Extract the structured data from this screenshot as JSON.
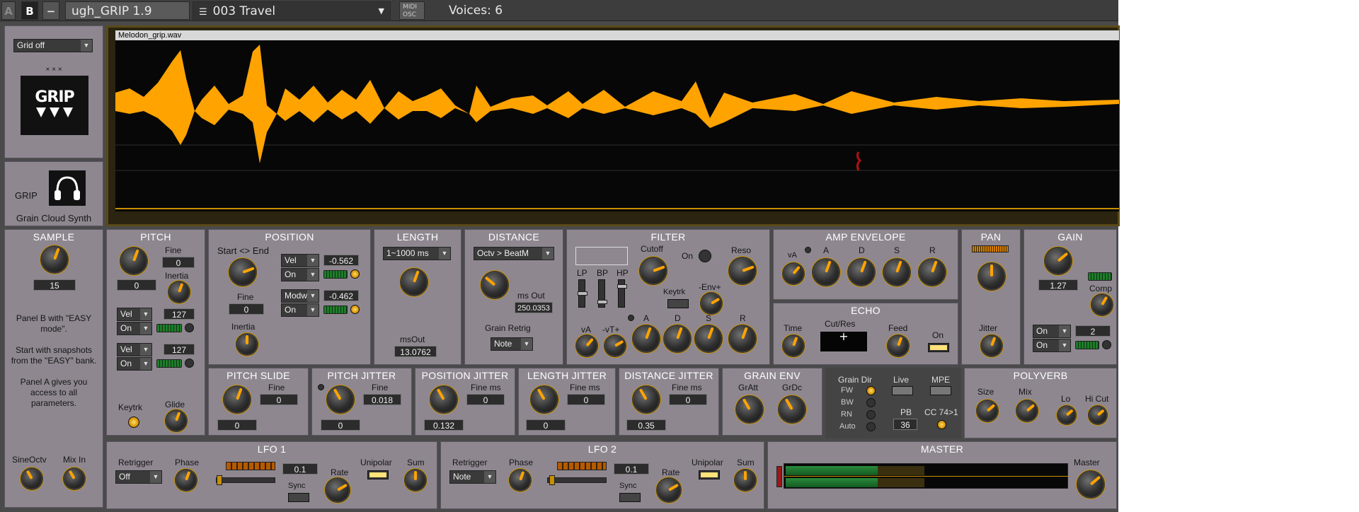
{
  "topbar": {
    "a": "A",
    "b": "B",
    "minus": "−",
    "name": "ugh_GRIP 1.9",
    "preset": "003   Travel",
    "midi1": "MIDI",
    "midi2": "OSC",
    "voices": "Voices: 6"
  },
  "grid": {
    "mode": "Grid off",
    "dots": "× × ×",
    "logo": "GRIP",
    "app": "GRIP",
    "subtitle": "Grain Cloud Synth"
  },
  "wave": {
    "filename": "Melodon_grip.wav"
  },
  "sample": {
    "title": "SAMPLE",
    "value": "15",
    "note": "Panel B with \"EASY mode\".\n\nStart with snapshots from the \"EASY\" bank.\n\nPanel A gives you access to all parameters.",
    "sineoctv": "SineOctv",
    "mixin": "Mix In"
  },
  "pitch": {
    "title": "PITCH",
    "fine": "Fine",
    "fine_val": "0",
    "val": "0",
    "inertia": "Inertia",
    "vel": "Vel",
    "vel_val": "127",
    "on": "On",
    "vel2": "Vel",
    "vel2_val": "127",
    "on2": "On",
    "keytrk": "Keytrk",
    "glide": "Glide"
  },
  "position": {
    "title": "POSITION",
    "startend": "Start <> End",
    "vel": "Vel",
    "vel_val": "-0.562",
    "on": "On",
    "fine": "Fine",
    "fine_val": "0",
    "modw": "Modw",
    "modw_val": "-0.462",
    "on2": "On",
    "inertia": "Inertia"
  },
  "length": {
    "title": "LENGTH",
    "range": "1~1000 ms",
    "msout": "msOut",
    "msout_val": "13.0762"
  },
  "distance": {
    "title": "DISTANCE",
    "mode": "Octv > BeatM",
    "msout": "ms Out",
    "msout_val": "250.0353",
    "retrig": "Grain Retrig",
    "retrig_val": "Note"
  },
  "filter": {
    "title": "FILTER",
    "cutoff": "Cutoff",
    "on": "On",
    "reso": "Reso",
    "lp": "LP",
    "bp": "BP",
    "hp": "HP",
    "keytrk": "Keytrk",
    "env": "-Env+",
    "va": "vA",
    "vt": "-vT+",
    "a": "A",
    "d": "D",
    "s": "S",
    "r": "R"
  },
  "amp": {
    "title": "AMP ENVELOPE",
    "va": "vA",
    "a": "A",
    "d": "D",
    "s": "S",
    "r": "R"
  },
  "echo": {
    "title": "ECHO",
    "time": "Time",
    "cutres": "Cut/Res",
    "feed": "Feed",
    "on": "On"
  },
  "pan": {
    "title": "PAN",
    "jitter": "Jitter"
  },
  "gain": {
    "title": "GAIN",
    "val": "1.27",
    "comp": "Comp",
    "on1": "On",
    "on2": "On",
    "num": "2"
  },
  "pslide": {
    "title": "PITCH SLIDE",
    "fine": "Fine",
    "fine_val": "0",
    "val": "0"
  },
  "pjitter": {
    "title": "PITCH JITTER",
    "fine": "Fine",
    "fine_val": "0.018",
    "val": "0"
  },
  "posjit": {
    "title": "POSITION JITTER",
    "fine": "Fine ms",
    "fine_val": "0",
    "val": "0.132"
  },
  "lenjit": {
    "title": "LENGTH JITTER",
    "fine": "Fine ms",
    "fine_val": "0",
    "val": "0"
  },
  "distjit": {
    "title": "DISTANCE JITTER",
    "fine": "Fine ms",
    "fine_val": "0",
    "val": "0.35"
  },
  "genv": {
    "title": "GRAIN ENV",
    "gratt": "GrAtt",
    "grdc": "GrDc"
  },
  "gdir": {
    "label": "Grain Dir",
    "fw": "FW",
    "bw": "BW",
    "rn": "RN",
    "auto": "Auto",
    "live": "Live",
    "mpe": "MPE",
    "pb": "PB",
    "pb_val": "36",
    "cc": "CC 74>1"
  },
  "polyverb": {
    "title": "POLYVERB",
    "size": "Size",
    "mix": "Mix",
    "lo": "Lo",
    "hicut": "Hi Cut"
  },
  "lfo1": {
    "title": "LFO 1",
    "retrig": "Retrigger",
    "retrig_val": "Off",
    "phase": "Phase",
    "val": "0.1",
    "sync": "Sync",
    "rate": "Rate",
    "unipolar": "Unipolar",
    "sum": "Sum"
  },
  "lfo2": {
    "title": "LFO 2",
    "retrig": "Retrigger",
    "retrig_val": "Note",
    "phase": "Phase",
    "val": "0.1",
    "sync": "Sync",
    "rate": "Rate",
    "unipolar": "Unipolar",
    "sum": "Sum"
  },
  "master": {
    "title": "MASTER",
    "master": "Master"
  },
  "colors": {
    "accent": "#ffa300",
    "panel": "#8e8790",
    "bg": "#4a4a4a"
  }
}
